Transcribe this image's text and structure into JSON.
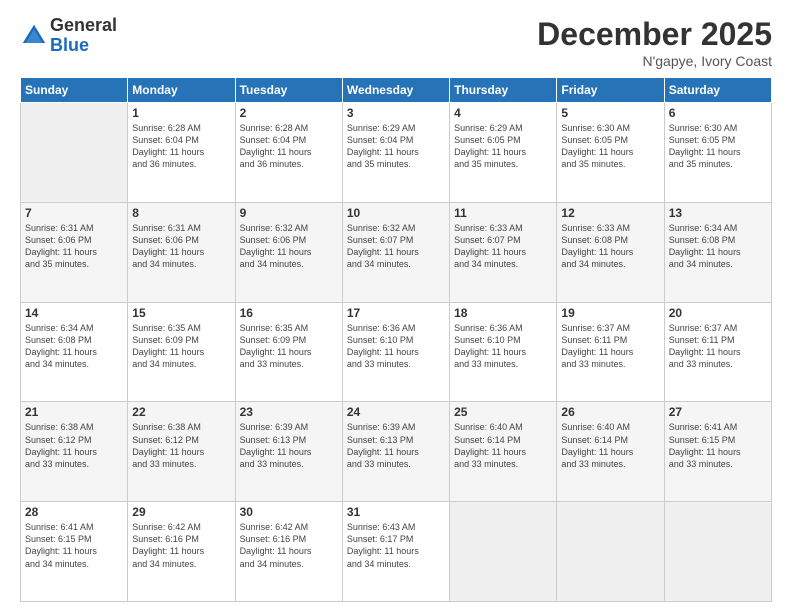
{
  "logo": {
    "general": "General",
    "blue": "Blue"
  },
  "header": {
    "month": "December 2025",
    "location": "N'gapye, Ivory Coast"
  },
  "weekdays": [
    "Sunday",
    "Monday",
    "Tuesday",
    "Wednesday",
    "Thursday",
    "Friday",
    "Saturday"
  ],
  "weeks": [
    [
      {
        "day": "",
        "info": ""
      },
      {
        "day": "1",
        "info": "Sunrise: 6:28 AM\nSunset: 6:04 PM\nDaylight: 11 hours\nand 36 minutes."
      },
      {
        "day": "2",
        "info": "Sunrise: 6:28 AM\nSunset: 6:04 PM\nDaylight: 11 hours\nand 36 minutes."
      },
      {
        "day": "3",
        "info": "Sunrise: 6:29 AM\nSunset: 6:04 PM\nDaylight: 11 hours\nand 35 minutes."
      },
      {
        "day": "4",
        "info": "Sunrise: 6:29 AM\nSunset: 6:05 PM\nDaylight: 11 hours\nand 35 minutes."
      },
      {
        "day": "5",
        "info": "Sunrise: 6:30 AM\nSunset: 6:05 PM\nDaylight: 11 hours\nand 35 minutes."
      },
      {
        "day": "6",
        "info": "Sunrise: 6:30 AM\nSunset: 6:05 PM\nDaylight: 11 hours\nand 35 minutes."
      }
    ],
    [
      {
        "day": "7",
        "info": "Sunrise: 6:31 AM\nSunset: 6:06 PM\nDaylight: 11 hours\nand 35 minutes."
      },
      {
        "day": "8",
        "info": "Sunrise: 6:31 AM\nSunset: 6:06 PM\nDaylight: 11 hours\nand 34 minutes."
      },
      {
        "day": "9",
        "info": "Sunrise: 6:32 AM\nSunset: 6:06 PM\nDaylight: 11 hours\nand 34 minutes."
      },
      {
        "day": "10",
        "info": "Sunrise: 6:32 AM\nSunset: 6:07 PM\nDaylight: 11 hours\nand 34 minutes."
      },
      {
        "day": "11",
        "info": "Sunrise: 6:33 AM\nSunset: 6:07 PM\nDaylight: 11 hours\nand 34 minutes."
      },
      {
        "day": "12",
        "info": "Sunrise: 6:33 AM\nSunset: 6:08 PM\nDaylight: 11 hours\nand 34 minutes."
      },
      {
        "day": "13",
        "info": "Sunrise: 6:34 AM\nSunset: 6:08 PM\nDaylight: 11 hours\nand 34 minutes."
      }
    ],
    [
      {
        "day": "14",
        "info": "Sunrise: 6:34 AM\nSunset: 6:08 PM\nDaylight: 11 hours\nand 34 minutes."
      },
      {
        "day": "15",
        "info": "Sunrise: 6:35 AM\nSunset: 6:09 PM\nDaylight: 11 hours\nand 34 minutes."
      },
      {
        "day": "16",
        "info": "Sunrise: 6:35 AM\nSunset: 6:09 PM\nDaylight: 11 hours\nand 33 minutes."
      },
      {
        "day": "17",
        "info": "Sunrise: 6:36 AM\nSunset: 6:10 PM\nDaylight: 11 hours\nand 33 minutes."
      },
      {
        "day": "18",
        "info": "Sunrise: 6:36 AM\nSunset: 6:10 PM\nDaylight: 11 hours\nand 33 minutes."
      },
      {
        "day": "19",
        "info": "Sunrise: 6:37 AM\nSunset: 6:11 PM\nDaylight: 11 hours\nand 33 minutes."
      },
      {
        "day": "20",
        "info": "Sunrise: 6:37 AM\nSunset: 6:11 PM\nDaylight: 11 hours\nand 33 minutes."
      }
    ],
    [
      {
        "day": "21",
        "info": "Sunrise: 6:38 AM\nSunset: 6:12 PM\nDaylight: 11 hours\nand 33 minutes."
      },
      {
        "day": "22",
        "info": "Sunrise: 6:38 AM\nSunset: 6:12 PM\nDaylight: 11 hours\nand 33 minutes."
      },
      {
        "day": "23",
        "info": "Sunrise: 6:39 AM\nSunset: 6:13 PM\nDaylight: 11 hours\nand 33 minutes."
      },
      {
        "day": "24",
        "info": "Sunrise: 6:39 AM\nSunset: 6:13 PM\nDaylight: 11 hours\nand 33 minutes."
      },
      {
        "day": "25",
        "info": "Sunrise: 6:40 AM\nSunset: 6:14 PM\nDaylight: 11 hours\nand 33 minutes."
      },
      {
        "day": "26",
        "info": "Sunrise: 6:40 AM\nSunset: 6:14 PM\nDaylight: 11 hours\nand 33 minutes."
      },
      {
        "day": "27",
        "info": "Sunrise: 6:41 AM\nSunset: 6:15 PM\nDaylight: 11 hours\nand 33 minutes."
      }
    ],
    [
      {
        "day": "28",
        "info": "Sunrise: 6:41 AM\nSunset: 6:15 PM\nDaylight: 11 hours\nand 34 minutes."
      },
      {
        "day": "29",
        "info": "Sunrise: 6:42 AM\nSunset: 6:16 PM\nDaylight: 11 hours\nand 34 minutes."
      },
      {
        "day": "30",
        "info": "Sunrise: 6:42 AM\nSunset: 6:16 PM\nDaylight: 11 hours\nand 34 minutes."
      },
      {
        "day": "31",
        "info": "Sunrise: 6:43 AM\nSunset: 6:17 PM\nDaylight: 11 hours\nand 34 minutes."
      },
      {
        "day": "",
        "info": ""
      },
      {
        "day": "",
        "info": ""
      },
      {
        "day": "",
        "info": ""
      }
    ]
  ]
}
